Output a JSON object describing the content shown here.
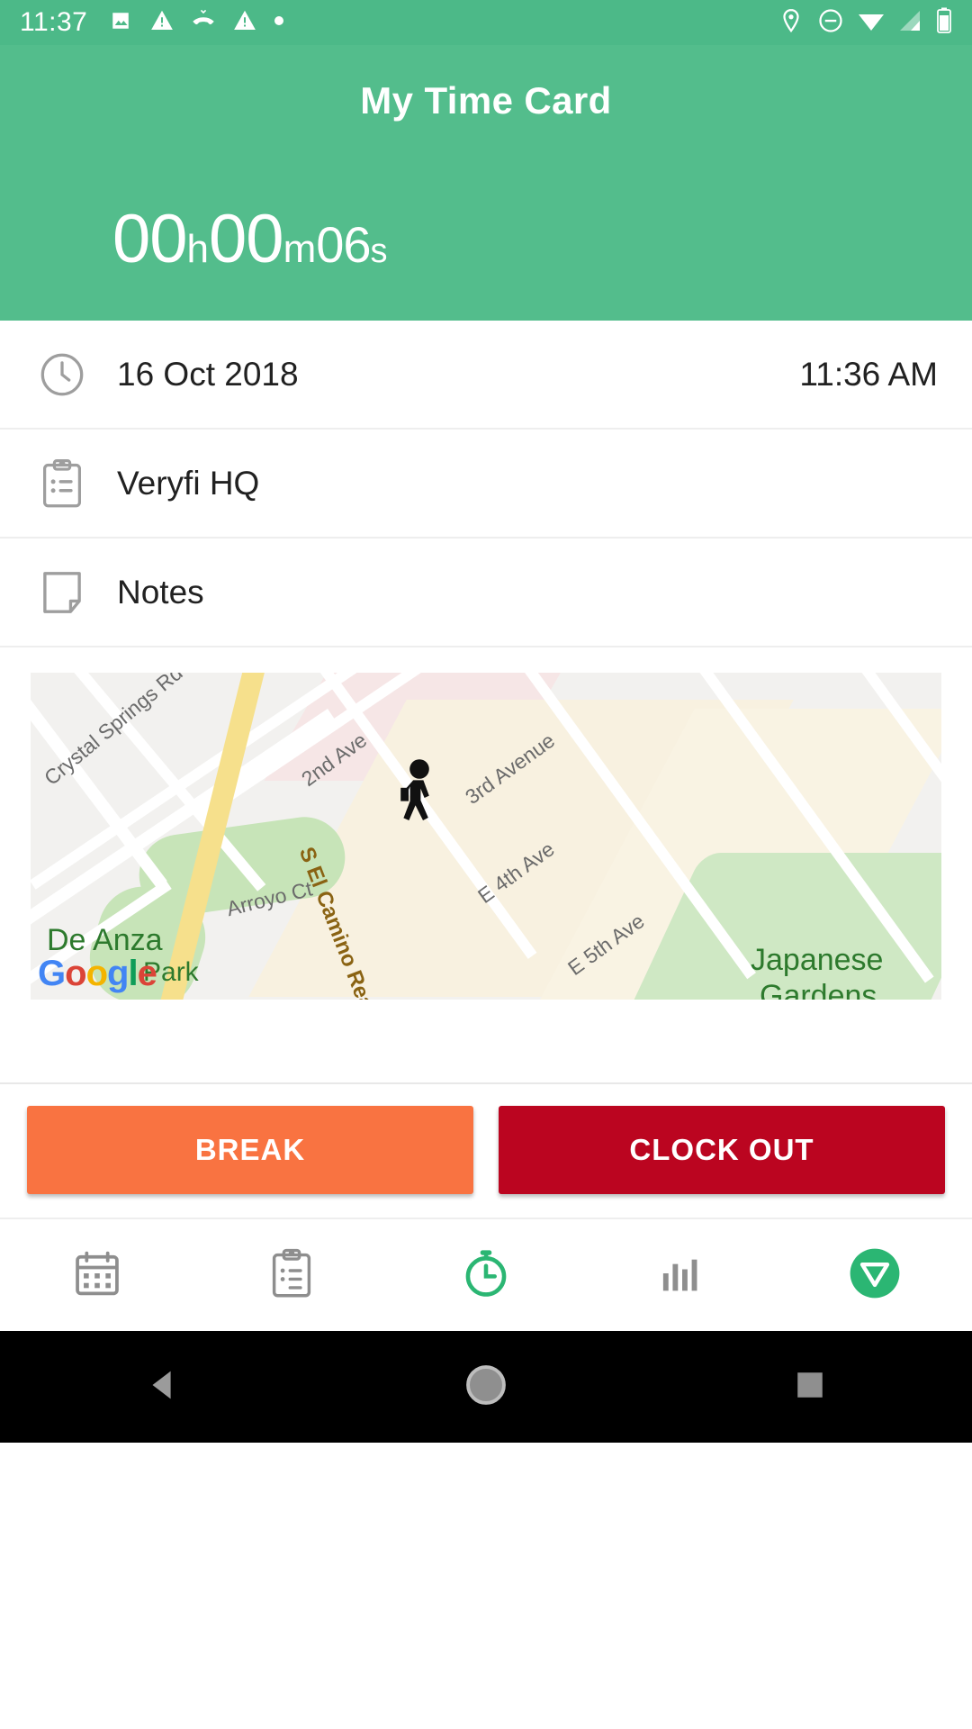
{
  "status_bar": {
    "clock": "11:37",
    "left_icons": [
      "image-icon",
      "warning-icon",
      "missed-call-icon",
      "warning-icon",
      "dot-icon"
    ],
    "right_icons": [
      "location-icon",
      "do-not-disturb-icon",
      "wifi-icon",
      "cellular-signal-icon",
      "battery-icon"
    ]
  },
  "app_bar": {
    "title": "My Time Card"
  },
  "timer": {
    "hours": "00",
    "hours_unit": "h",
    "minutes": "00",
    "minutes_unit": "m",
    "seconds": "06",
    "seconds_unit": "s",
    "full": "00h00m06s"
  },
  "rows": [
    {
      "icon": "clock-icon",
      "label": "16 Oct 2018",
      "value": "11:36 AM"
    },
    {
      "icon": "clipboard-icon",
      "label": "Veryfi HQ",
      "value": ""
    },
    {
      "icon": "note-icon",
      "label": "Notes",
      "value": ""
    }
  ],
  "map": {
    "attribution": "Google",
    "attribution_letters": [
      "G",
      "o",
      "o",
      "g",
      "l",
      "e"
    ],
    "labels": [
      "Crystal Springs Rd",
      "2nd Ave",
      "3rd Avenue",
      "Arroyo Ct",
      "S El Camino Real",
      "E 4th Ave",
      "E 5th Ave",
      "De Anza",
      "Park",
      "Japanese",
      "Gardens"
    ],
    "marker": "pedestrian-icon"
  },
  "actions": [
    {
      "label": "BREAK",
      "color": "#f97341",
      "name": "break-button"
    },
    {
      "label": "CLOCK OUT",
      "color": "#bb0520",
      "name": "clock-out-button"
    }
  ],
  "bottom_nav": [
    {
      "icon": "calendar-icon",
      "name": "nav-calendar",
      "active": false
    },
    {
      "icon": "clipboard-icon",
      "name": "nav-projects",
      "active": false
    },
    {
      "icon": "stopwatch-icon",
      "name": "nav-timer",
      "active": true
    },
    {
      "icon": "bar-chart-icon",
      "name": "nav-reports",
      "active": false
    },
    {
      "icon": "veryfi-logo-icon",
      "name": "nav-account",
      "active": true
    }
  ],
  "android_nav": [
    {
      "icon": "back-triangle-icon",
      "name": "android-back"
    },
    {
      "icon": "home-circle-icon",
      "name": "android-home"
    },
    {
      "icon": "recents-square-icon",
      "name": "android-recents"
    }
  ],
  "colors": {
    "brand_green": "#53bd8c",
    "status_green": "#4cb988",
    "accent_green": "#2bb673",
    "break_orange": "#f97341",
    "clock_out_red": "#bb0520"
  }
}
